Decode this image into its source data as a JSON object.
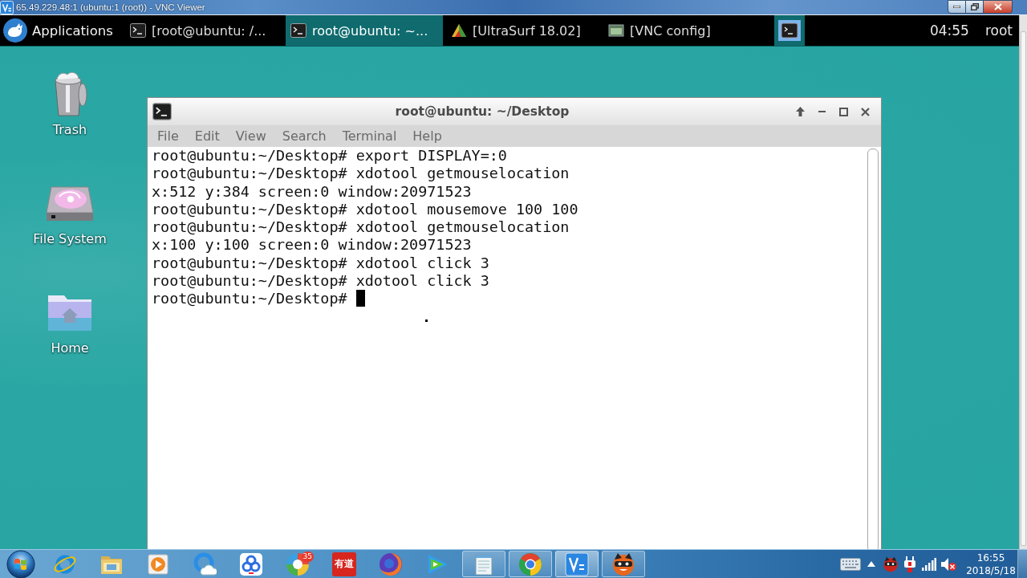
{
  "vnc_window": {
    "title": "65.49.229.48:1 (ubuntu:1 (root)) - VNC Viewer"
  },
  "panel": {
    "menu_label": "Applications",
    "tasks": [
      {
        "label": "[root@ubuntu: /...",
        "kind": "terminal",
        "selected": false
      },
      {
        "label": "root@ubuntu: ~...",
        "kind": "terminal",
        "selected": true
      },
      {
        "label": "[UltraSurf 18.02]",
        "kind": "app",
        "selected": false
      },
      {
        "label": "[VNC config]",
        "kind": "window",
        "selected": false
      }
    ],
    "workspaces": [
      {
        "selected": true
      }
    ],
    "clock": "04:55",
    "user": "root"
  },
  "desktop_icons": [
    {
      "label": "Trash",
      "kind": "trash"
    },
    {
      "label": "File System",
      "kind": "drive"
    },
    {
      "label": "Home",
      "kind": "home"
    }
  ],
  "terminal": {
    "title": "root@ubuntu: ~/Desktop",
    "menu": [
      "File",
      "Edit",
      "View",
      "Search",
      "Terminal",
      "Help"
    ],
    "lines": [
      "root@ubuntu:~/Desktop# export DISPLAY=:0",
      "root@ubuntu:~/Desktop# xdotool getmouselocation",
      "x:512 y:384 screen:0 window:20971523",
      "root@ubuntu:~/Desktop# xdotool mousemove 100 100",
      "root@ubuntu:~/Desktop# xdotool getmouselocation",
      "x:100 y:100 screen:0 window:20971523",
      "root@ubuntu:~/Desktop# xdotool click 3",
      "root@ubuntu:~/Desktop# xdotool click 3",
      "root@ubuntu:~/Desktop#"
    ],
    "cursor": true
  },
  "taskbar": {
    "apps": [
      {
        "kind": "orbit",
        "running": false,
        "selected": false
      },
      {
        "kind": "folder",
        "running": false,
        "selected": false
      },
      {
        "kind": "media",
        "running": false,
        "selected": false
      },
      {
        "kind": "cloud-ring",
        "running": false,
        "selected": false
      },
      {
        "kind": "rings-tile",
        "running": false,
        "selected": false
      },
      {
        "kind": "segmented",
        "badge": "35",
        "running": false,
        "selected": false
      },
      {
        "kind": "text-tile",
        "label": "有道",
        "running": false,
        "selected": false
      },
      {
        "kind": "globe",
        "running": false,
        "selected": false
      },
      {
        "kind": "play-triangle",
        "running": false,
        "selected": false
      },
      {
        "kind": "notepad",
        "running": true,
        "selected": false
      },
      {
        "kind": "tricolor",
        "running": true,
        "selected": false
      },
      {
        "kind": "logo-tile",
        "running": true,
        "selected": true
      },
      {
        "kind": "cat-face",
        "running": true,
        "selected": false
      }
    ],
    "tray": [
      {
        "kind": "keyboard"
      },
      {
        "kind": "expand"
      },
      {
        "kind": "cat-face"
      },
      {
        "kind": "plug"
      },
      {
        "kind": "signal"
      },
      {
        "kind": "speaker-muted"
      }
    ],
    "time": "16:55",
    "date": "2018/5/18"
  }
}
